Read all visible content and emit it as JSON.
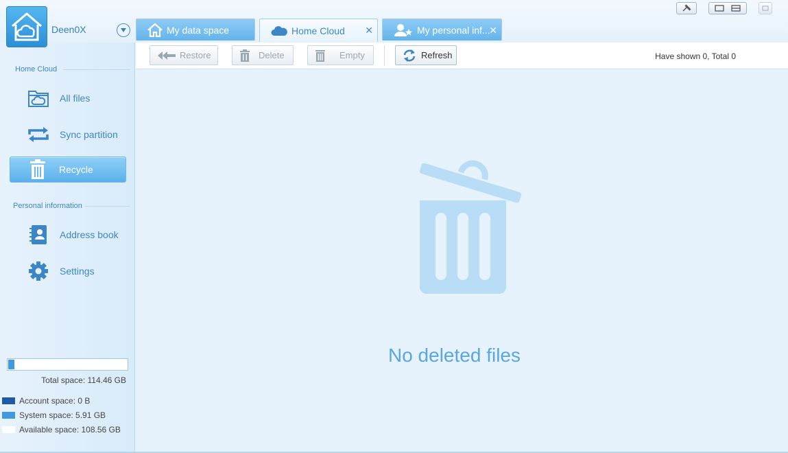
{
  "app": {
    "username": "Deen0X"
  },
  "tabs": [
    {
      "label": "My data space",
      "icon": "home-icon",
      "active": false,
      "closable": false
    },
    {
      "label": "Home Cloud",
      "icon": "cloud-icon",
      "active": true,
      "closable": true
    },
    {
      "label": "My personal inf...",
      "icon": "person-star-icon",
      "active": false,
      "closable": true
    }
  ],
  "sidebar": {
    "section_home": "Home Cloud",
    "items_home": [
      {
        "label": "All files",
        "icon": "folder-cloud-icon"
      },
      {
        "label": "Sync partition",
        "icon": "sync-icon"
      },
      {
        "label": "Recycle",
        "icon": "trash-icon",
        "selected": true
      }
    ],
    "section_personal": "Personal information",
    "items_personal": [
      {
        "label": "Address book",
        "icon": "address-book-icon"
      },
      {
        "label": "Settings",
        "icon": "gear-icon"
      }
    ],
    "storage": {
      "used_fraction": 0.052,
      "total_label": "Total space: 114.46 GB",
      "legend": [
        {
          "label": "Account space: 0 B",
          "color": "#1d5aa8"
        },
        {
          "label": "System space: 5.91 GB",
          "color": "#3f9ae0"
        },
        {
          "label": "Available space: 108.56 GB",
          "color": "#ffffff"
        }
      ]
    }
  },
  "toolbar": {
    "restore_label": "Restore",
    "delete_label": "Delete",
    "empty_label": "Empty",
    "refresh_label": "Refresh",
    "count_text": "Have shown 0, Total 0"
  },
  "main": {
    "empty_message": "No deleted files"
  },
  "colors": {
    "accent": "#3d86c6",
    "tab_inactive": "#64b4ec",
    "empty_icon": "#b9dcf7"
  }
}
